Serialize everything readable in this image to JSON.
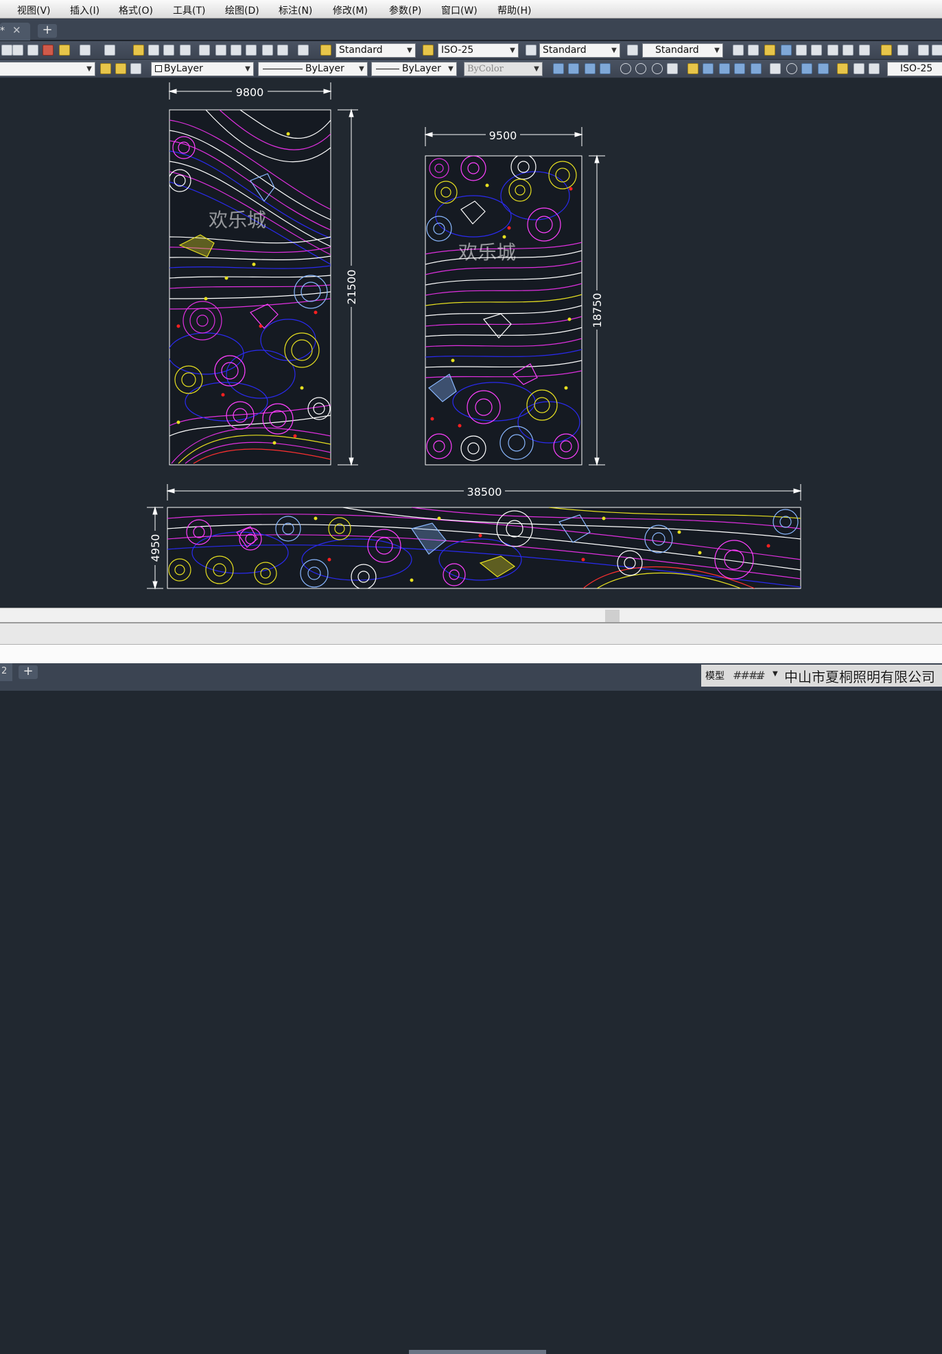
{
  "menubar": {
    "items": [
      "视图(V)",
      "插入(I)",
      "格式(O)",
      "工具(T)",
      "绘图(D)",
      "标注(N)",
      "修改(M)",
      "参数(P)",
      "窗口(W)",
      "帮助(H)"
    ]
  },
  "tabs": {
    "doc_label": "*",
    "close": "✕",
    "new": "+"
  },
  "toolbar1": {
    "text_style": "Standard",
    "dim_style": "ISO-25",
    "table_style": "Standard",
    "mleader_style": "Standard"
  },
  "toolbar2": {
    "color": "ByLayer",
    "linetype": "ByLayer",
    "lineweight": "ByLayer",
    "plotstyle": "ByColor",
    "dim_style": "ISO-25"
  },
  "drawing": {
    "panel1": {
      "width_dim": "9800",
      "height_dim": "21500"
    },
    "panel2": {
      "width_dim": "9500",
      "height_dim": "18750"
    },
    "panel3": {
      "width_dim": "38500",
      "height_dim": "4950"
    },
    "logo_text": "欢乐城"
  },
  "statusbar": {
    "layout_tab": "2",
    "add": "+",
    "model": "模型",
    "grid": "####",
    "snap": "::::",
    "company": "中山市夏桐照明有限公司"
  }
}
